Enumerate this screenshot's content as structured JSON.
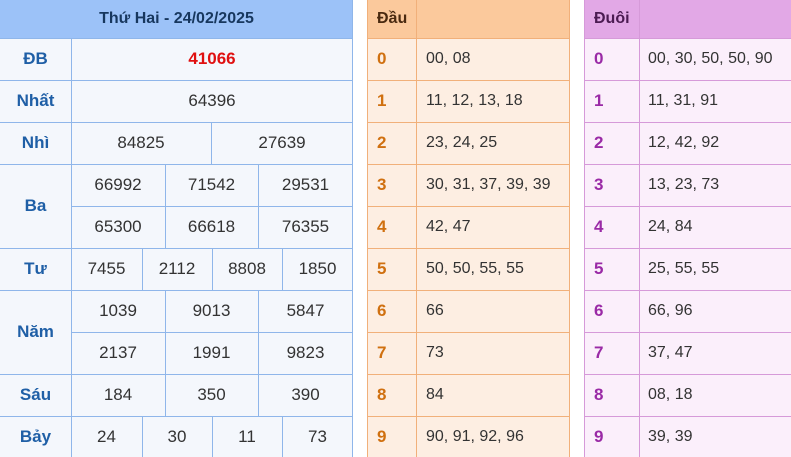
{
  "results": {
    "title": "Thứ Hai - 24/02/2025",
    "prizes": {
      "db": {
        "label": "ĐB",
        "numbers": [
          "41066"
        ]
      },
      "nhat": {
        "label": "Nhất",
        "numbers": [
          "64396"
        ]
      },
      "nhi": {
        "label": "Nhì",
        "numbers": [
          "84825",
          "27639"
        ]
      },
      "ba": {
        "label": "Ba",
        "numbers": [
          "66992",
          "71542",
          "29531",
          "65300",
          "66618",
          "76355"
        ]
      },
      "tu": {
        "label": "Tư",
        "numbers": [
          "7455",
          "2112",
          "8808",
          "1850"
        ]
      },
      "nam": {
        "label": "Năm",
        "numbers": [
          "1039",
          "9013",
          "5847",
          "2137",
          "1991",
          "9823"
        ]
      },
      "sau": {
        "label": "Sáu",
        "numbers": [
          "184",
          "350",
          "390"
        ]
      },
      "bay": {
        "label": "Bảy",
        "numbers": [
          "24",
          "30",
          "11",
          "73"
        ]
      }
    }
  },
  "heads": {
    "header": "Đầu",
    "rows": [
      {
        "key": "0",
        "value": "00, 08"
      },
      {
        "key": "1",
        "value": "11, 12, 13, 18"
      },
      {
        "key": "2",
        "value": "23, 24, 25"
      },
      {
        "key": "3",
        "value": "30, 31, 37, 39, 39"
      },
      {
        "key": "4",
        "value": "42, 47"
      },
      {
        "key": "5",
        "value": "50, 50, 55, 55"
      },
      {
        "key": "6",
        "value": "66"
      },
      {
        "key": "7",
        "value": "73"
      },
      {
        "key": "8",
        "value": "84"
      },
      {
        "key": "9",
        "value": "90, 91, 92, 96"
      }
    ]
  },
  "tails": {
    "header": "Đuôi",
    "rows": [
      {
        "key": "0",
        "value": "00, 30, 50, 50, 90"
      },
      {
        "key": "1",
        "value": "11, 31, 91"
      },
      {
        "key": "2",
        "value": "12, 42, 92"
      },
      {
        "key": "3",
        "value": "13, 23, 73"
      },
      {
        "key": "4",
        "value": "24, 84"
      },
      {
        "key": "5",
        "value": "25, 55, 55"
      },
      {
        "key": "6",
        "value": "66, 96"
      },
      {
        "key": "7",
        "value": "37, 47"
      },
      {
        "key": "8",
        "value": "08, 18"
      },
      {
        "key": "9",
        "value": "39, 39"
      }
    ]
  },
  "colors": {
    "results_header": "#9cc2f8",
    "heads_header": "#fbc99c",
    "tails_header": "#e2a8e6",
    "special_number": "#e01010"
  }
}
